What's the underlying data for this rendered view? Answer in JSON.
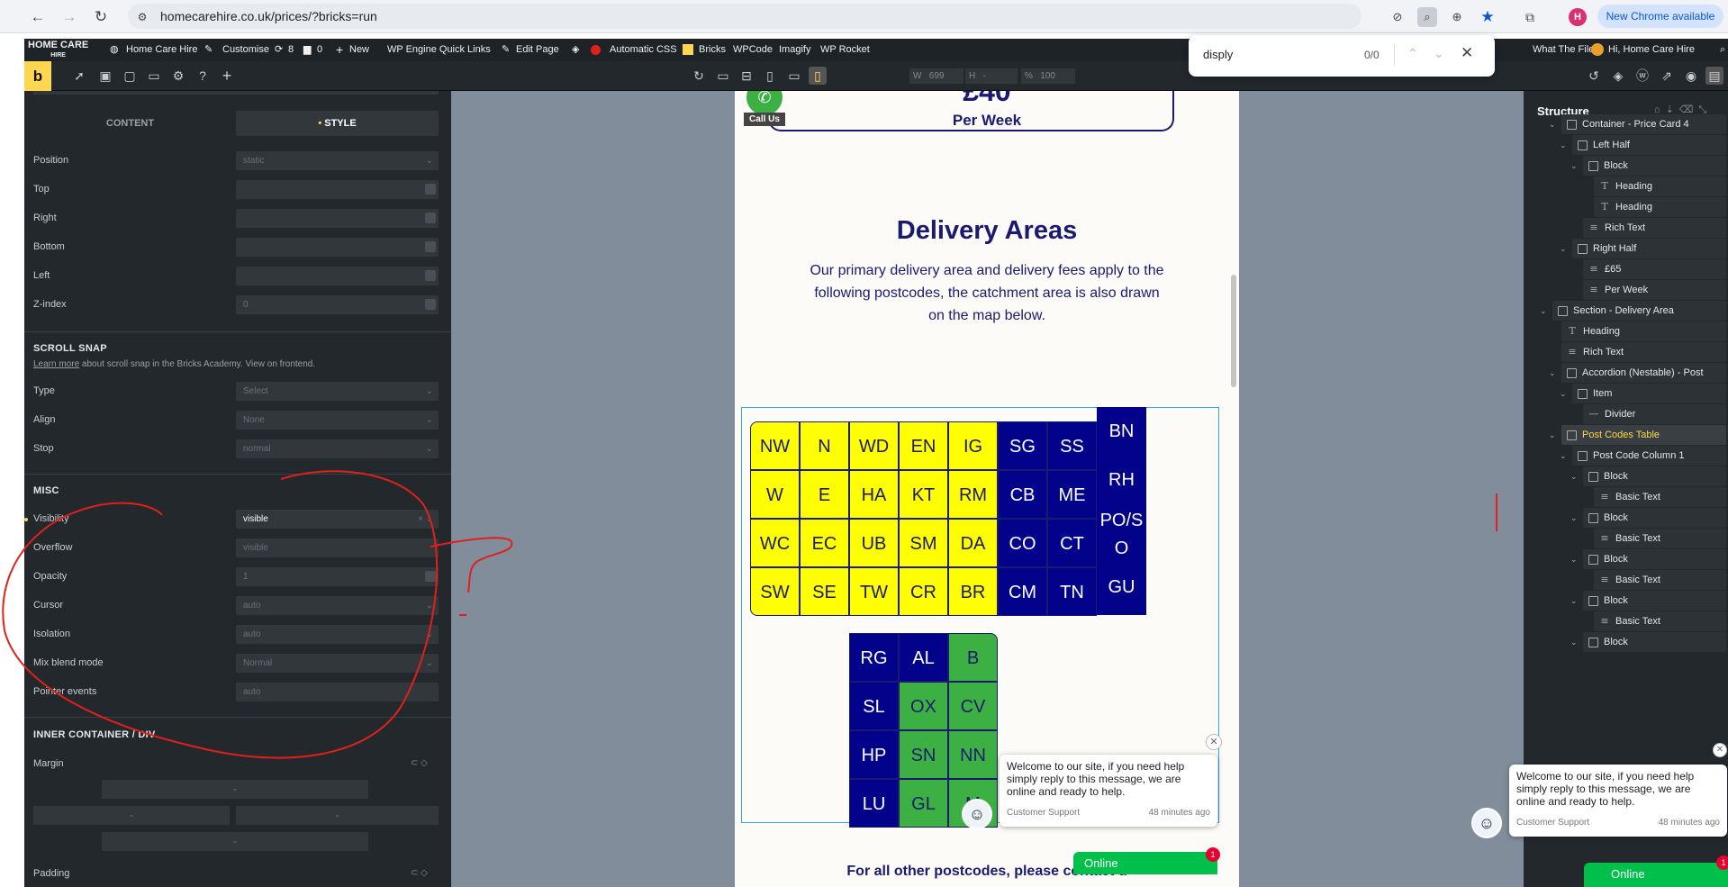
{
  "browser": {
    "url": "homecarehire.co.uk/prices/?bricks=run",
    "new_chrome": "New Chrome available",
    "profile_initial": "H"
  },
  "find": {
    "query": "disply",
    "count": "0/0"
  },
  "wpbar": {
    "logo_line1": "HOME CARE",
    "logo_line2": "HIRE",
    "site": "Home Care Hire",
    "customise": "Customise",
    "updates": "8",
    "comments": "0",
    "new": "New",
    "engine": "WP Engine Quick Links",
    "edit": "Edit Page",
    "acss": "Automatic CSS",
    "bricks": "Bricks",
    "wpcode": "WPCode",
    "imagify": "Imagify",
    "rocket": "WP Rocket",
    "whatfile": "What The File",
    "greeting": "Hi, Home Care Hire"
  },
  "toolbar": {
    "w_label": "W",
    "w_value": "699",
    "h_label": "H",
    "h_value": "-",
    "zoom_label": "%",
    "zoom_value": "100"
  },
  "left": {
    "tab_content": "CONTENT",
    "tab_style": "STYLE",
    "position": {
      "label": "Position",
      "value": "static"
    },
    "top": "Top",
    "right": "Right",
    "bottom": "Bottom",
    "left": "Left",
    "zindex": {
      "label": "Z-index",
      "value": "0"
    },
    "scroll_snap": "SCROLL SNAP",
    "learn_more": "Learn more",
    "learn_rest": " about scroll snap in the Bricks Academy. View on frontend.",
    "type": {
      "label": "Type",
      "value": "Select"
    },
    "align": {
      "label": "Align",
      "value": "None"
    },
    "stop": {
      "label": "Stop",
      "value": "normal"
    },
    "misc": "MISC",
    "visibility": {
      "label": "Visibility",
      "value": "visible"
    },
    "overflow": {
      "label": "Overflow",
      "value": "visible"
    },
    "opacity": {
      "label": "Opacity",
      "value": "1"
    },
    "cursor": {
      "label": "Cursor",
      "value": "auto"
    },
    "isolation": {
      "label": "Isolation",
      "value": "auto"
    },
    "blend": {
      "label": "Mix blend mode",
      "value": "Normal"
    },
    "pointer": {
      "label": "Pointer events",
      "value": "auto"
    },
    "inner": "INNER CONTAINER / DIV",
    "margin": "Margin",
    "padding": "Padding",
    "dash": "-"
  },
  "page": {
    "call_us": "Call Us",
    "price": "£40",
    "per_week": "Per Week",
    "heading": "Delivery Areas",
    "intro": [
      "Our primary delivery area and delivery fees apply to the",
      "following postcodes, the catchment area is also drawn",
      "on the map below."
    ],
    "footer": "For all other postcodes, please contact u"
  },
  "postcodes": {
    "yellow": [
      [
        "NW",
        "N",
        "WD",
        "EN",
        "IG"
      ],
      [
        "W",
        "E",
        "HA",
        "KT",
        "RM"
      ],
      [
        "WC",
        "EC",
        "UB",
        "SM",
        "DA"
      ],
      [
        "SW",
        "SE",
        "TW",
        "CR",
        "BR"
      ]
    ],
    "navy": [
      [
        "SG",
        "SS"
      ],
      [
        "CB",
        "ME"
      ],
      [
        "CO",
        "CT"
      ],
      [
        "CM",
        "TN"
      ]
    ],
    "col3": [
      "BN",
      "RH",
      "PO/S",
      "O",
      "GU"
    ],
    "lower": [
      [
        "RG",
        "AL",
        "B"
      ],
      [
        "SL",
        "OX",
        "CV"
      ],
      [
        "HP",
        "SN",
        "NN"
      ],
      [
        "LU",
        "GL",
        "M"
      ]
    ]
  },
  "chat": {
    "message": "Welcome to our site, if you need help simply reply to this message, we are online and ready to help.",
    "sender": "Customer Support",
    "time": "48 minutes ago",
    "online": "Online",
    "badge": "1"
  },
  "structure": {
    "title": "Structure",
    "items": [
      {
        "label": "Container - Price Card 4",
        "kind": "box"
      },
      {
        "label": "Left Half",
        "kind": "box"
      },
      {
        "label": "Block",
        "kind": "box"
      },
      {
        "label": "Heading",
        "kind": "T"
      },
      {
        "label": "Heading",
        "kind": "T"
      },
      {
        "label": "Rich Text",
        "kind": "lines"
      },
      {
        "label": "Right Half",
        "kind": "box"
      },
      {
        "label": "£65",
        "kind": "lines"
      },
      {
        "label": "Per Week",
        "kind": "lines"
      },
      {
        "label": "Section - Delivery Area",
        "kind": "box"
      },
      {
        "label": "Heading",
        "kind": "T"
      },
      {
        "label": "Rich Text",
        "kind": "lines"
      },
      {
        "label": "Accordion (Nestable) - Post",
        "kind": "box"
      },
      {
        "label": "Item",
        "kind": "box"
      },
      {
        "label": "Divider",
        "kind": "dash"
      },
      {
        "label": "Post Codes Table",
        "kind": "box"
      },
      {
        "label": "Post Code Column 1",
        "kind": "box"
      },
      {
        "label": "Block",
        "kind": "box"
      },
      {
        "label": "Basic Text",
        "kind": "lines"
      },
      {
        "label": "Block",
        "kind": "box"
      },
      {
        "label": "Basic Text",
        "kind": "lines"
      },
      {
        "label": "Block",
        "kind": "box"
      },
      {
        "label": "Basic Text",
        "kind": "lines"
      },
      {
        "label": "Block",
        "kind": "box"
      },
      {
        "label": "Basic Text",
        "kind": "lines"
      },
      {
        "label": "Block",
        "kind": "box"
      }
    ]
  },
  "colors": {
    "accent": "#ffd64f",
    "navy": "#02028a",
    "yellow": "#ffff00",
    "green": "#3cb043",
    "heading": "#1a1a6e",
    "annotation": "#e0201b"
  }
}
